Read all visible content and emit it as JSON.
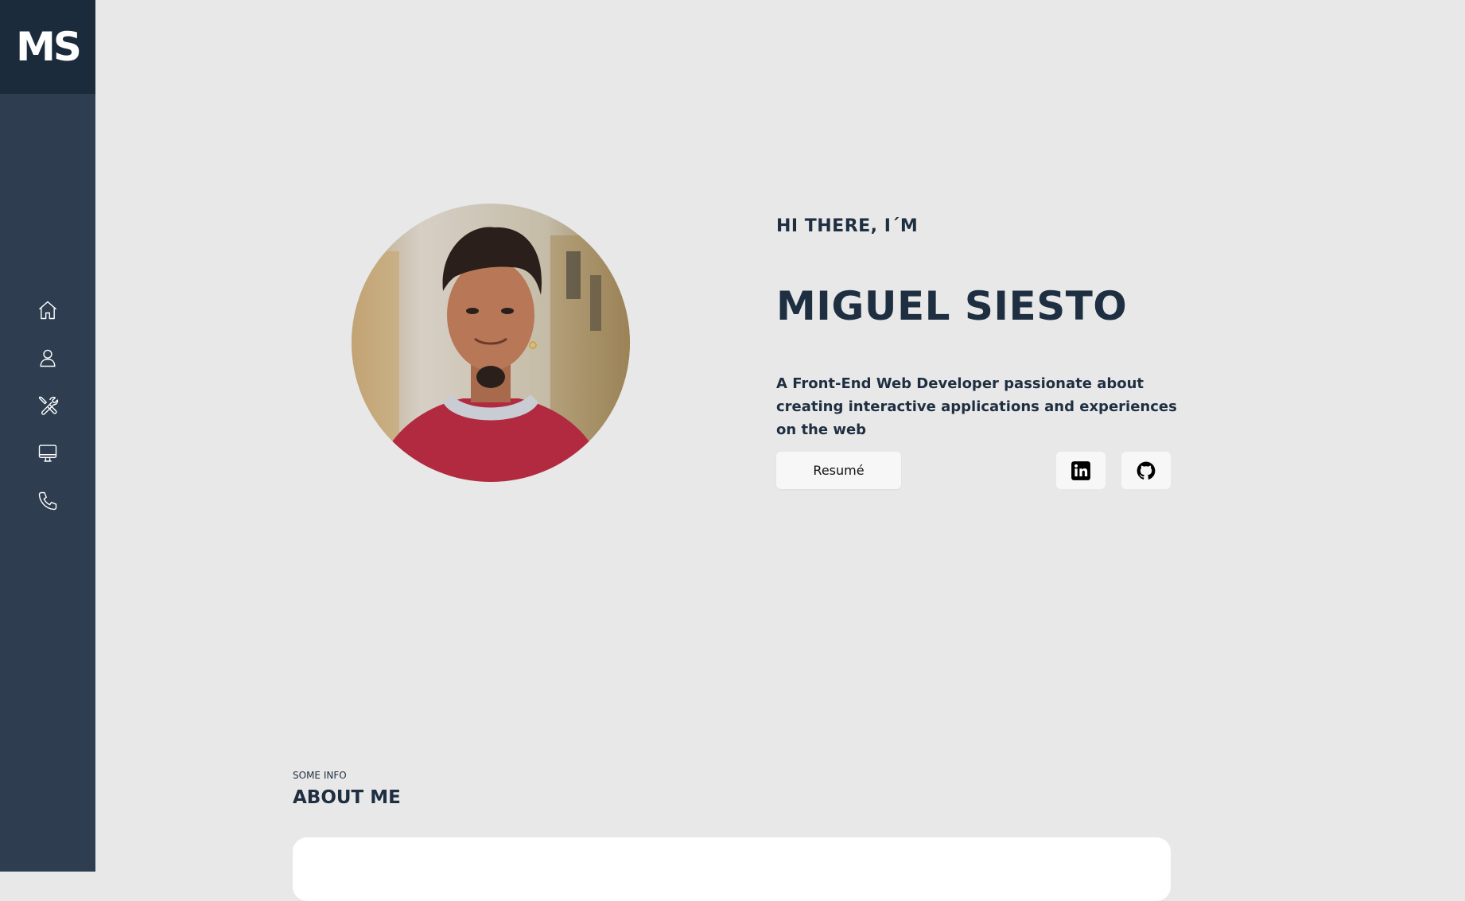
{
  "logo": {
    "text": "MS"
  },
  "nav": {
    "items": [
      {
        "icon": "home-icon"
      },
      {
        "icon": "user-icon"
      },
      {
        "icon": "tools-icon"
      },
      {
        "icon": "monitor-icon"
      },
      {
        "icon": "phone-icon"
      }
    ]
  },
  "hero": {
    "greeting": "HI THERE, I´M",
    "name": "MIGUEL SIESTO",
    "tagline": "A Front-End Web Developer passionate about creating interactive applications and experiences on the web",
    "resume_label": "Resumé",
    "socials": [
      {
        "icon": "linkedin-icon"
      },
      {
        "icon": "github-icon"
      }
    ]
  },
  "about": {
    "kicker": "SOME INFO",
    "title": "ABOUT ME"
  },
  "colors": {
    "sidebar": "#2e3e50",
    "logo_bg": "#1c2b3c",
    "page_bg": "#e8e8e8",
    "text_dark": "#1f2f42"
  }
}
